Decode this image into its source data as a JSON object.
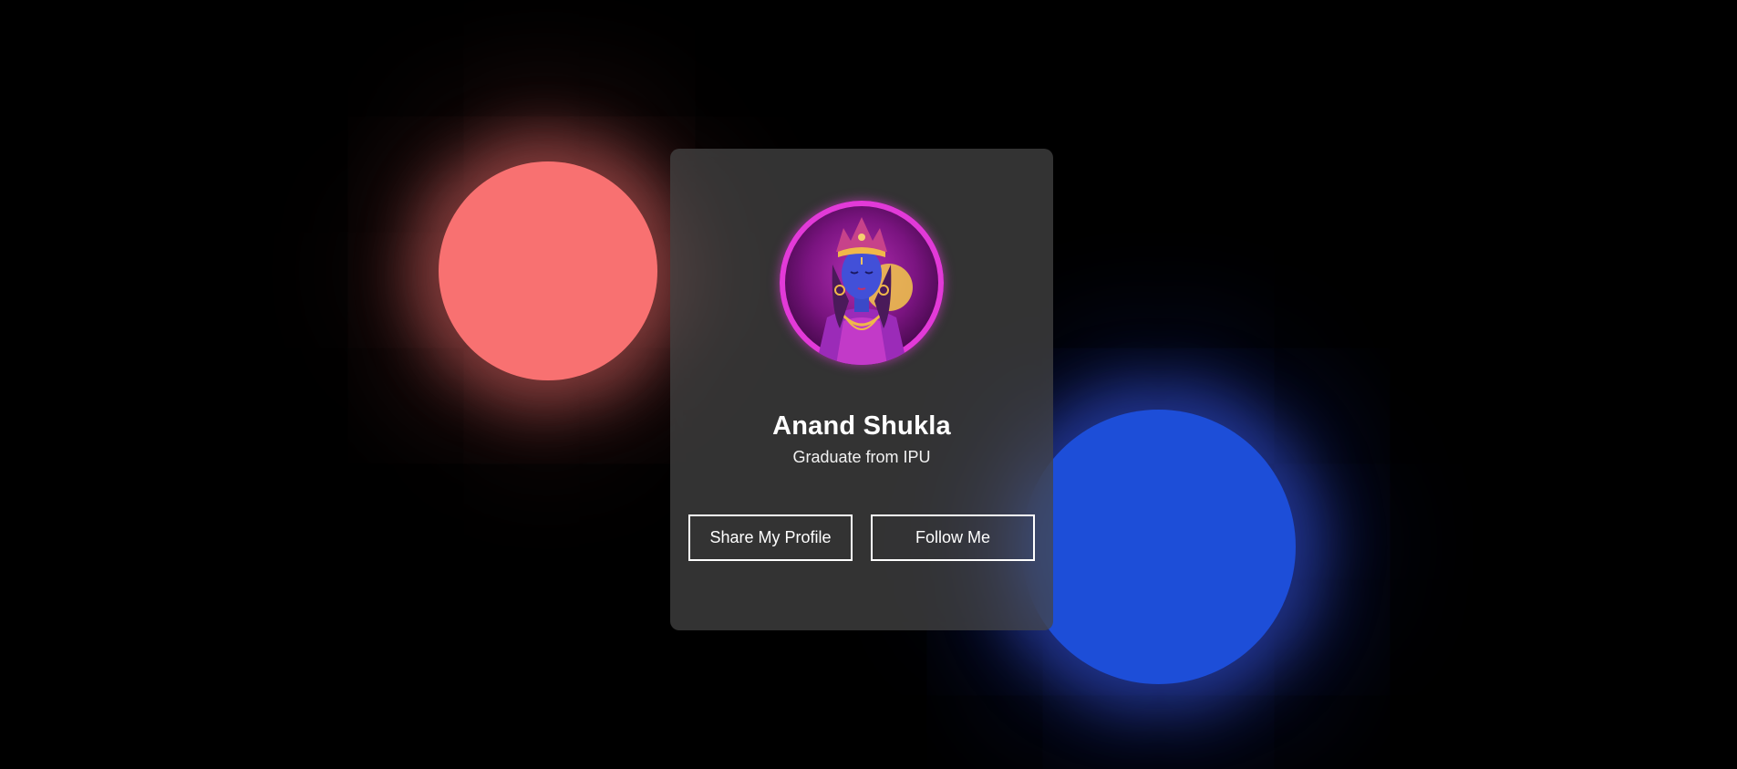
{
  "profile": {
    "name": "Anand Shukla",
    "subtitle": "Graduate from IPU"
  },
  "actions": {
    "share_label": "Share My Profile",
    "follow_label": "Follow Me"
  },
  "colors": {
    "background": "#000000",
    "red_blob": "#f87171",
    "blue_blob": "#1d4ed8",
    "card": "#3a3a3a",
    "avatar_ring": "#e23ad8"
  },
  "icons": {
    "avatar": "profile-portrait"
  }
}
